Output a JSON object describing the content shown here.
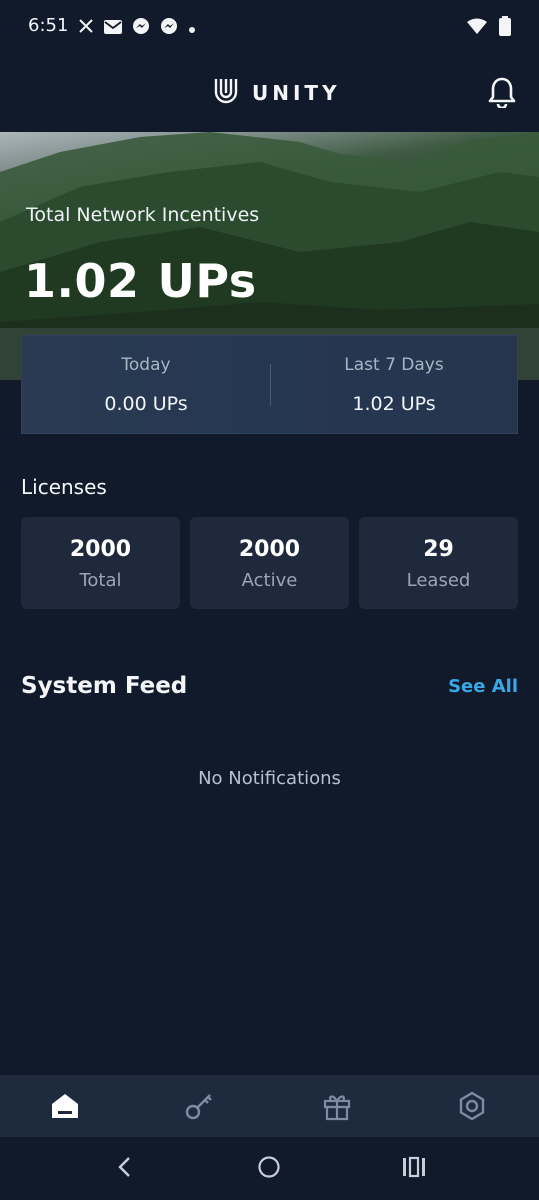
{
  "status_bar": {
    "time": "6:51",
    "notification_icons": [
      "x-icon",
      "mail-icon",
      "messenger-icon",
      "messenger-icon",
      "dot-icon"
    ],
    "system_icons": [
      "wifi-icon",
      "battery-icon"
    ]
  },
  "header": {
    "brand": "UNITY",
    "logo_icon": "unity-logo-icon",
    "notification_icon": "bell-icon"
  },
  "hero": {
    "label": "Total Network Incentives",
    "value": "1.02",
    "unit": "UPs"
  },
  "stats": {
    "today_label": "Today",
    "today_value": "0.00  UPs",
    "week_label": "Last 7 Days",
    "week_value": "1.02  UPs"
  },
  "licenses": {
    "title": "Licenses",
    "cards": [
      {
        "value": "2000",
        "label": "Total"
      },
      {
        "value": "2000",
        "label": "Active"
      },
      {
        "value": "29",
        "label": "Leased"
      }
    ]
  },
  "feed": {
    "title": "System Feed",
    "see_all": "See All",
    "empty_text": "No Notifications"
  },
  "tabs": [
    "home-icon",
    "key-icon",
    "gift-icon",
    "settings-icon"
  ],
  "colors": {
    "background": "#111a2b",
    "card": "#1e2a3c",
    "accent": "#3aa7e6"
  }
}
